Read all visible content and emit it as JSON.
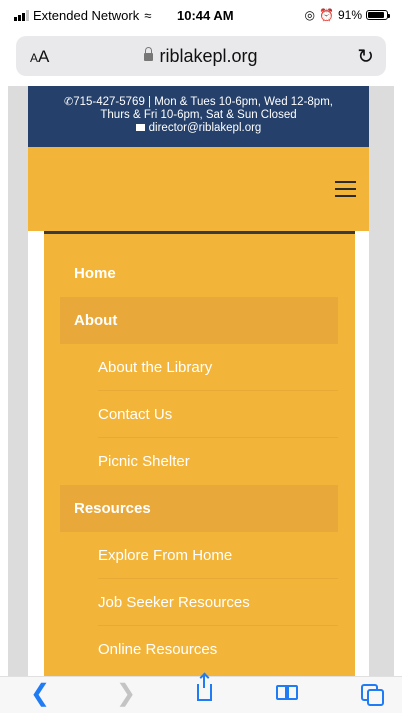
{
  "status_bar": {
    "carrier": "Extended Network",
    "time": "10:44 AM",
    "battery": "91%",
    "battery_level": 0.91
  },
  "url_bar": {
    "text_size_label": "AA",
    "domain": "riblakepl.org"
  },
  "info_bar": {
    "line1": "715-427-5769 | Mon & Tues 10-6pm, Wed 12-8pm,",
    "line2": "Thurs & Fri 10-6pm, Sat & Sun Closed",
    "email": "director@riblakepl.org"
  },
  "menu": {
    "items": [
      {
        "label": "Home"
      },
      {
        "label": "About"
      },
      {
        "label": "About the Library"
      },
      {
        "label": "Contact Us"
      },
      {
        "label": "Picnic Shelter"
      },
      {
        "label": "Resources"
      },
      {
        "label": "Explore From Home"
      },
      {
        "label": "Job Seeker Resources"
      },
      {
        "label": "Online Resources"
      }
    ]
  },
  "colors": {
    "header_navy": "#25406a",
    "menu_gold": "#f3b539",
    "menu_highlight": "#e9a93a",
    "safari_blue": "#1f7cf4"
  },
  "icons": {
    "back": "chevron-left-icon",
    "forward": "chevron-right-icon",
    "share": "share-icon",
    "bookmarks": "book-icon",
    "tabs": "tabs-icon",
    "reload": "reload-icon"
  }
}
